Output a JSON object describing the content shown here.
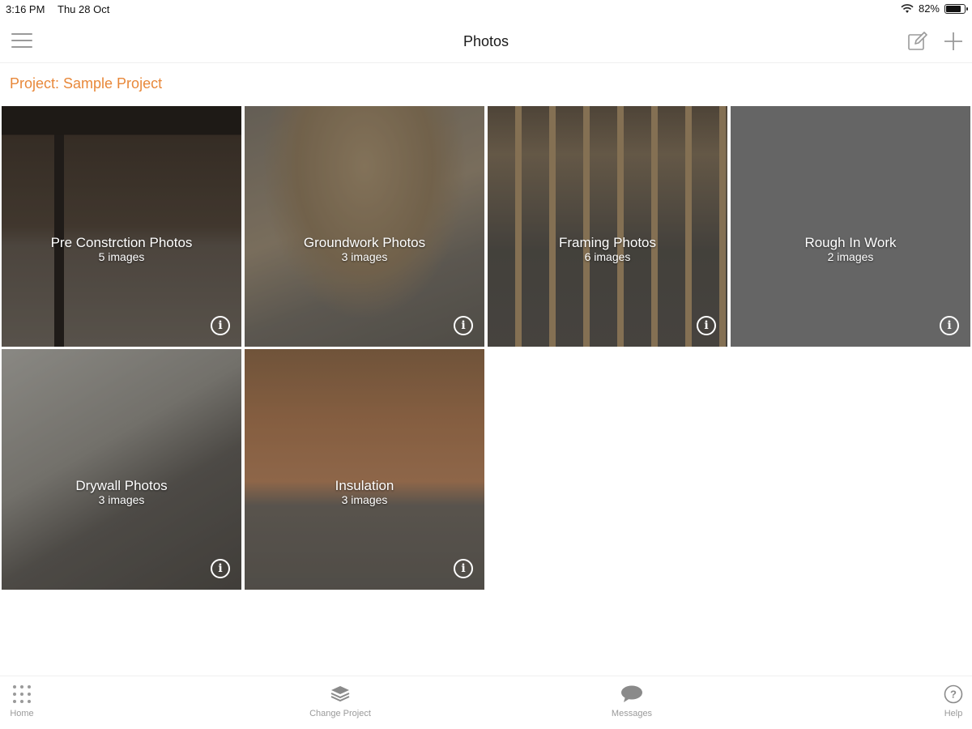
{
  "status_bar": {
    "time": "3:16 PM",
    "date": "Thu 28 Oct",
    "battery": "82%",
    "battery_level": 0.82
  },
  "header": {
    "title": "Photos"
  },
  "project": {
    "label": "Project: Sample Project"
  },
  "albums": [
    {
      "title": "Pre Constrction Photos",
      "count": "5 images",
      "style": "bg-pre"
    },
    {
      "title": "Groundwork Photos",
      "count": "3 images",
      "style": "bg-ground"
    },
    {
      "title": "Framing Photos",
      "count": "6 images",
      "style": "bg-frame"
    },
    {
      "title": "Rough In Work",
      "count": "2 images",
      "style": "bg-rough"
    },
    {
      "title": "Drywall Photos",
      "count": "3 images",
      "style": "bg-dry"
    },
    {
      "title": "Insulation",
      "count": "3 images",
      "style": "bg-insul"
    }
  ],
  "tabbar": {
    "home": "Home",
    "change_project": "Change Project",
    "messages": "Messages",
    "help": "Help"
  },
  "icons": {
    "menu": "menu-icon",
    "edit": "edit-icon",
    "add": "plus-icon",
    "info": "info-icon",
    "home": "grid-icon",
    "change_project": "layers-icon",
    "messages": "chat-bubble-icon",
    "help": "question-icon"
  },
  "colors": {
    "accent": "#e8883a",
    "tab_label": "#9a9a9a"
  }
}
